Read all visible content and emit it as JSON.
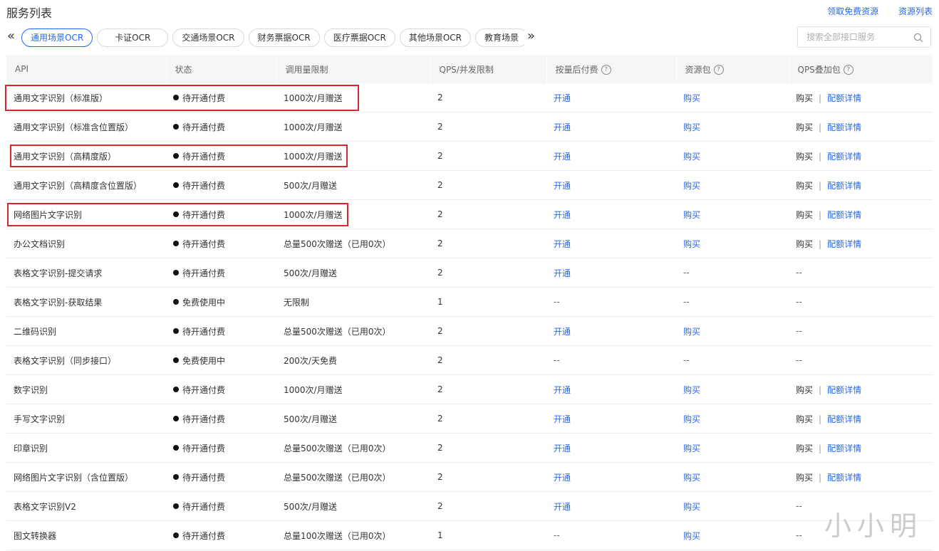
{
  "header": {
    "title": "服务列表",
    "links": [
      "领取免费资源",
      "资源列表"
    ]
  },
  "tabs": {
    "prev_icon": "«",
    "next_icon": "»",
    "items": [
      "通用场景OCR",
      "卡证OCR",
      "交通场景OCR",
      "财务票据OCR",
      "医疗票据OCR",
      "其他场景OCR",
      "教育场景"
    ],
    "active_index": 0
  },
  "search": {
    "placeholder": "搜索全部接口服务"
  },
  "table": {
    "columns": [
      "API",
      "状态",
      "调用量限制",
      "QPS/并发限制",
      "按量后付费",
      "资源包",
      "QPS叠加包"
    ],
    "rows": [
      {
        "api": "通用文字识别（标准版）",
        "status": "待开通付费",
        "limit": "1000次/月赠送",
        "qps": "2",
        "pay": "开通",
        "pack": "购买",
        "qps_pack": {
          "buy": "购买",
          "detail": "配额详情"
        }
      },
      {
        "api": "通用文字识别（标准含位置版）",
        "status": "待开通付费",
        "limit": "1000次/月赠送",
        "qps": "2",
        "pay": "开通",
        "pack": "购买",
        "qps_pack": {
          "buy": "购买",
          "detail": "配额详情"
        }
      },
      {
        "api": "通用文字识别（高精度版）",
        "status": "待开通付费",
        "limit": "1000次/月赠送",
        "qps": "2",
        "pay": "开通",
        "pack": "购买",
        "qps_pack": {
          "buy": "购买",
          "detail": "配额详情"
        }
      },
      {
        "api": "通用文字识别（高精度含位置版）",
        "status": "待开通付费",
        "limit": "500次/月赠送",
        "qps": "2",
        "pay": "开通",
        "pack": "购买",
        "qps_pack": {
          "buy": "购买",
          "detail": "配额详情"
        }
      },
      {
        "api": "网络图片文字识别",
        "status": "待开通付费",
        "limit": "1000次/月赠送",
        "qps": "2",
        "pay": "开通",
        "pack": "购买",
        "qps_pack": {
          "buy": "购买",
          "detail": "配额详情"
        }
      },
      {
        "api": "办公文档识别",
        "status": "待开通付费",
        "limit": "总量500次赠送（已用0次）",
        "qps": "2",
        "pay": "开通",
        "pack": "购买",
        "qps_pack": {
          "buy": "购买",
          "detail": "配额详情"
        }
      },
      {
        "api": "表格文字识别-提交请求",
        "status": "待开通付费",
        "limit": "500次/月赠送",
        "qps": "2",
        "pay": "开通",
        "pack": "--",
        "qps_pack": "--"
      },
      {
        "api": "表格文字识别-获取结果",
        "status": "免费使用中",
        "limit": "无限制",
        "qps": "1",
        "pay": "--",
        "pack": "--",
        "qps_pack": "--"
      },
      {
        "api": "二维码识别",
        "status": "待开通付费",
        "limit": "总量500次赠送（已用0次）",
        "qps": "2",
        "pay": "开通",
        "pack": "购买",
        "qps_pack": "--"
      },
      {
        "api": "表格文字识别（同步接口）",
        "status": "免费使用中",
        "limit": "200次/天免费",
        "qps": "2",
        "pay": "--",
        "pack": "--",
        "qps_pack": "--"
      },
      {
        "api": "数字识别",
        "status": "待开通付费",
        "limit": "1000次/月赠送",
        "qps": "2",
        "pay": "开通",
        "pack": "购买",
        "qps_pack": {
          "buy": "购买",
          "detail": "配额详情"
        }
      },
      {
        "api": "手写文字识别",
        "status": "待开通付费",
        "limit": "500次/月赠送",
        "qps": "2",
        "pay": "开通",
        "pack": "购买",
        "qps_pack": {
          "buy": "购买",
          "detail": "配额详情"
        }
      },
      {
        "api": "印章识别",
        "status": "待开通付费",
        "limit": "总量500次赠送（已用0次）",
        "qps": "2",
        "pay": "开通",
        "pack": "购买",
        "qps_pack": {
          "buy": "购买",
          "detail": "配额详情"
        }
      },
      {
        "api": "网络图片文字识别（含位置版）",
        "status": "待开通付费",
        "limit": "总量500次赠送（已用0次）",
        "qps": "2",
        "pay": "开通",
        "pack": "购买",
        "qps_pack": {
          "buy": "购买",
          "detail": "配额详情"
        }
      },
      {
        "api": "表格文字识别V2",
        "status": "待开通付费",
        "limit": "500次/月赠送",
        "qps": "2",
        "pay": "开通",
        "pack": "购买",
        "qps_pack": "--"
      },
      {
        "api": "图文转换器",
        "status": "待开通付费",
        "limit": "总量100次赠送（已用0次）",
        "qps": "1",
        "pay": "--",
        "pack": "购买",
        "qps_pack": "--"
      }
    ]
  },
  "watermark": "小小明",
  "colors": {
    "link": "#2468f2",
    "highlight": "#d9262c",
    "header_bg": "#f5f6f8"
  }
}
